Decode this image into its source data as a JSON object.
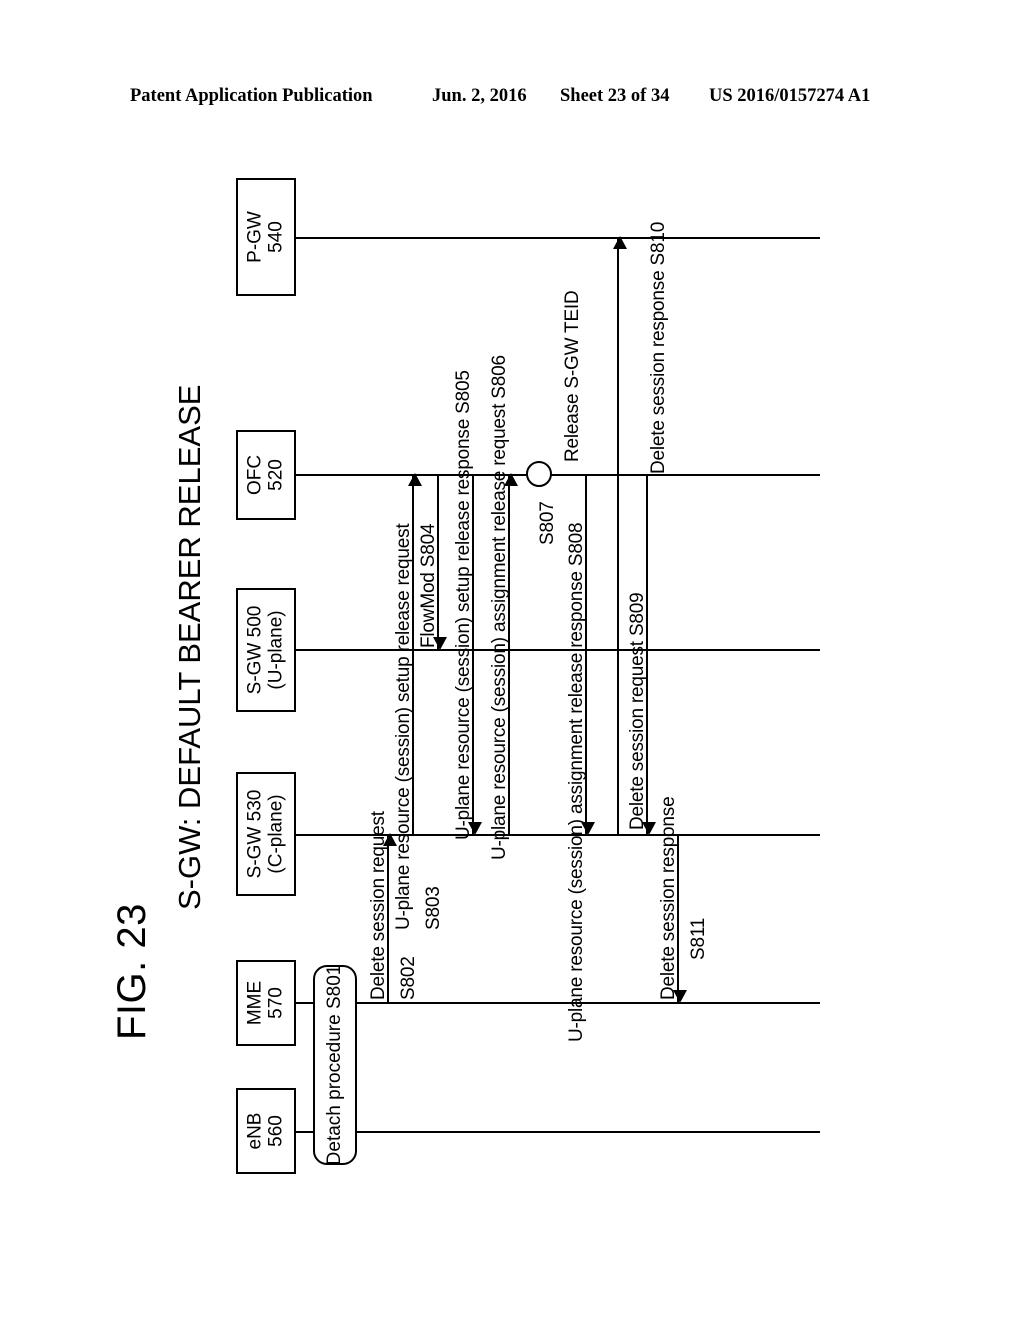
{
  "header": {
    "publication": "Patent Application Publication",
    "date": "Jun. 2, 2016",
    "sheet": "Sheet 23 of 34",
    "number": "US 2016/0157274 A1"
  },
  "figure": {
    "label": "FIG. 23",
    "title": "S-GW: DEFAULT BEARER RELEASE"
  },
  "nodes": [
    {
      "id": "pgw",
      "name": "P-GW",
      "ref": "540"
    },
    {
      "id": "ofc",
      "name": "OFC",
      "ref": "520"
    },
    {
      "id": "sgwu",
      "name": "S-GW 500",
      "ref": "(U-plane)"
    },
    {
      "id": "sgwc",
      "name": "S-GW 530",
      "ref": "(C-plane)"
    },
    {
      "id": "mme",
      "name": "MME",
      "ref": "570"
    },
    {
      "id": "enb",
      "name": "eNB",
      "ref": "560"
    }
  ],
  "fragments": [
    {
      "id": "s801",
      "label": "Detach procedure S801"
    }
  ],
  "markers": [
    {
      "id": "s807",
      "step": "S807",
      "label": "Release S-GW TEID"
    }
  ],
  "messages": [
    {
      "id": "s802",
      "label": "Delete session request",
      "step": "S802",
      "from": "mme",
      "to": "sgwc"
    },
    {
      "id": "s803",
      "label": "U-plane resource (session) setup release request",
      "step": "S803",
      "from": "sgwc",
      "to": "ofc"
    },
    {
      "id": "s804",
      "label": "FlowMod  S804",
      "step": "",
      "from": "ofc",
      "to": "sgwu"
    },
    {
      "id": "s805",
      "label": "U-plane resource (session) setup release response S805",
      "step": "",
      "from": "ofc",
      "to": "sgwc"
    },
    {
      "id": "s806",
      "label": "U-plane resource (session) assignment release request S806",
      "step": "",
      "from": "sgwc",
      "to": "ofc"
    },
    {
      "id": "s808",
      "label": "U-plane resource (session) assignment release response S808",
      "step": "",
      "from": "ofc",
      "to": "sgwc"
    },
    {
      "id": "s809",
      "label": "Delete session request S809",
      "step": "",
      "from": "ofc",
      "to": "sgwc"
    },
    {
      "id": "s810",
      "label": "Delete session response S810",
      "step": "",
      "from": "ofc",
      "to": "pgw"
    },
    {
      "id": "s811",
      "label": "Delete session response",
      "step": "S811",
      "from": "sgwc",
      "to": "mme"
    }
  ]
}
